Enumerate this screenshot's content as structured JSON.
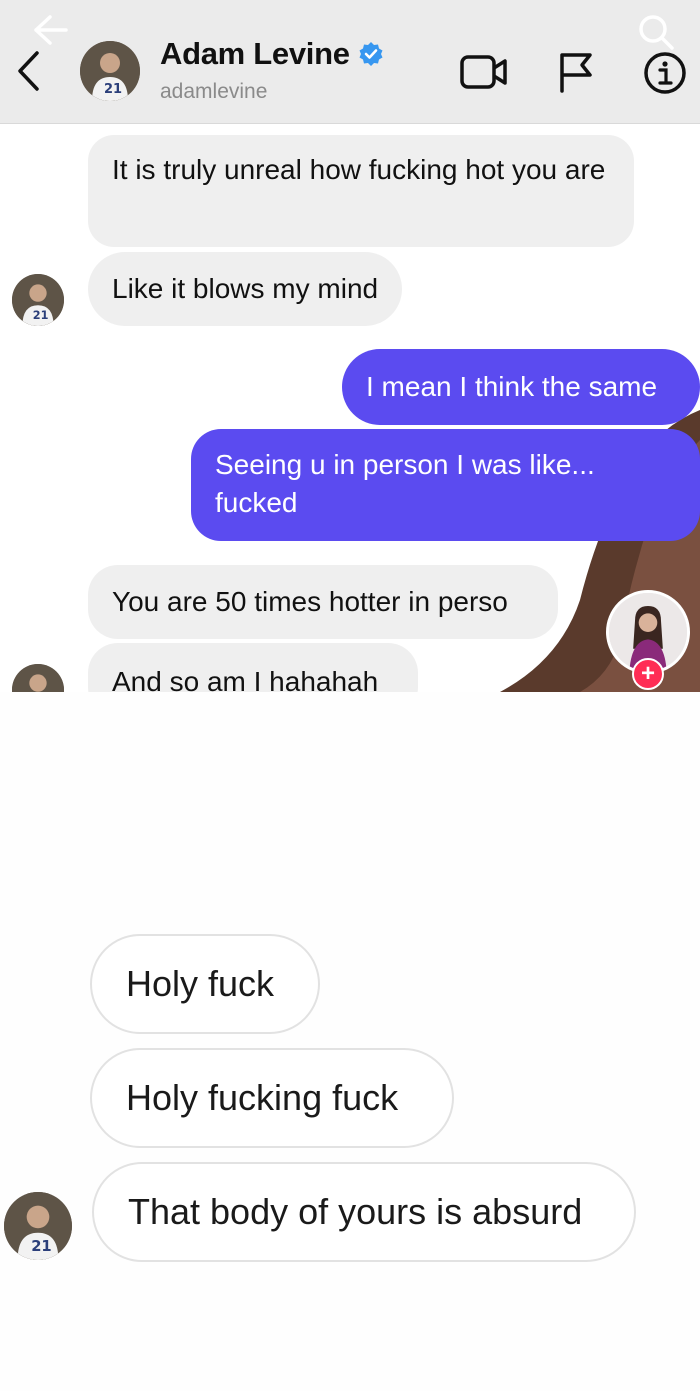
{
  "header": {
    "name": "Adam Levine",
    "username": "adamlevine",
    "back_icon": "chevron-left-icon",
    "overlay_back_icon": "arrow-left-icon",
    "search_icon": "search-icon",
    "video_icon": "video-camera-icon",
    "report_icon": "flag-icon",
    "info_icon": "info-icon",
    "verified_color": "#3797f0"
  },
  "conversation_top": {
    "messages": [
      {
        "from": "them",
        "text": "It is truly unreal how fucking hot you are"
      },
      {
        "from": "them",
        "text": "Like it blows my mind"
      },
      {
        "from": "me",
        "text": "I mean I think the same"
      },
      {
        "from": "me",
        "text": "Seeing u in person I was like...",
        "text2": "fucked"
      },
      {
        "from": "them",
        "text": "You are 50 times hotter in perso"
      },
      {
        "from": "them",
        "text": "And so am I hahahah"
      }
    ],
    "outgoing_color": "#5b4bf0",
    "incoming_color": "#efefef"
  },
  "overlay": {
    "add_label": "+",
    "add_color": "#ff2d55"
  },
  "conversation_bottom": {
    "messages": [
      {
        "from": "them",
        "text": "Holy fuck"
      },
      {
        "from": "them",
        "text": "Holy fucking fuck"
      },
      {
        "from": "them",
        "text": "That body of yours is absurd"
      }
    ]
  }
}
